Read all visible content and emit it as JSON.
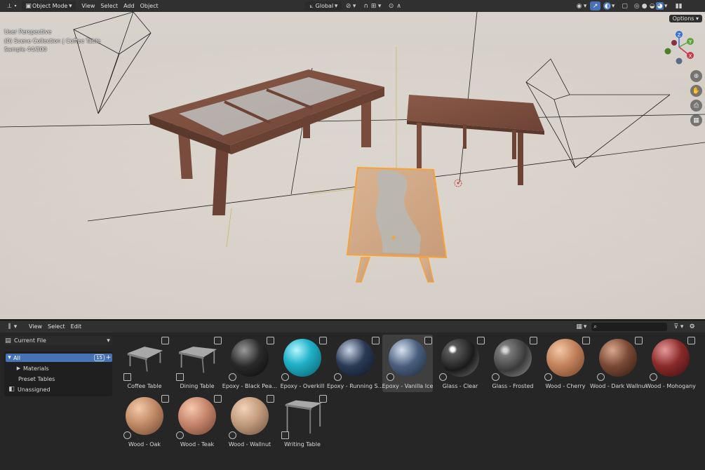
{
  "header": {
    "mode": "Object Mode",
    "menus": [
      "View",
      "Select",
      "Add",
      "Object"
    ],
    "orientation": "Global"
  },
  "viewport": {
    "perspective": "User Perspective",
    "collection": "(0) Scene Collection | Coffee Table",
    "sample": "Sample 44/300",
    "options_label": "Options",
    "gizmo": {
      "x": "X",
      "y": "Y",
      "z": "Z"
    }
  },
  "browser": {
    "menus": [
      "View",
      "Select",
      "Edit"
    ],
    "library": "Current File",
    "catalog": {
      "all": "All",
      "all_count": "15",
      "items": [
        "Materials",
        "Preset Tables",
        "Unassigned"
      ]
    },
    "assets": [
      {
        "label": "Coffee Table",
        "kind": "object"
      },
      {
        "label": "Dining Table",
        "kind": "object"
      },
      {
        "label": "Epoxy - Black Pea...",
        "kind": "material"
      },
      {
        "label": "Epoxy - Overkill",
        "kind": "material"
      },
      {
        "label": "Epoxy - Running S...",
        "kind": "material"
      },
      {
        "label": "Epoxy - Vanilla Ice",
        "kind": "material",
        "selected": true
      },
      {
        "label": "Glass - Clear",
        "kind": "material"
      },
      {
        "label": "Glass - Frosted",
        "kind": "material"
      },
      {
        "label": "Wood - Cherry",
        "kind": "material"
      },
      {
        "label": "Wood - Dark Wallnut",
        "kind": "material"
      },
      {
        "label": "Wood - Mohogany",
        "kind": "material"
      },
      {
        "label": "Wood - Oak",
        "kind": "material"
      },
      {
        "label": "Wood - Teak",
        "kind": "material"
      },
      {
        "label": "Wood - Wallnut",
        "kind": "material"
      },
      {
        "label": "Writing Table",
        "kind": "object"
      }
    ]
  },
  "colors": {
    "accent": "#4772b3",
    "selection_outline": "#f5a23a",
    "panel": "#303030"
  }
}
